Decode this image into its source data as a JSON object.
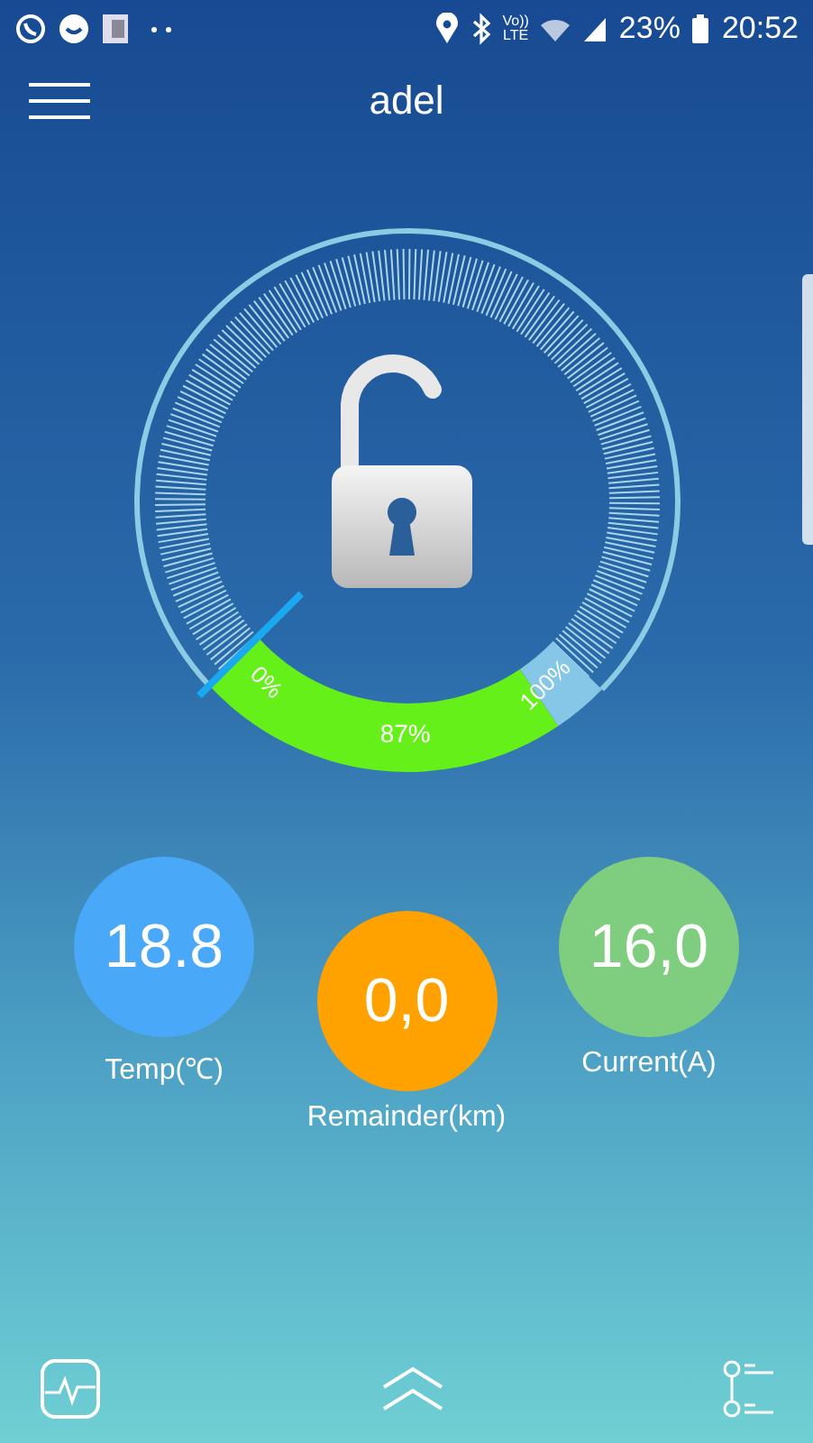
{
  "status_bar": {
    "volte_top": "Vo))",
    "volte_bottom": "LTE",
    "battery": "23%",
    "time": "20:52"
  },
  "header": {
    "title": "adel"
  },
  "gauge": {
    "locked": false,
    "start_label": "0%",
    "value_label": "87%",
    "end_label": "100%"
  },
  "metrics": [
    {
      "value": "18.8",
      "label": "Temp(℃)",
      "color": "#4aa8f8"
    },
    {
      "value": "0,0",
      "label": "Remainder(km)",
      "color": "#ffa200"
    },
    {
      "value": "16,0",
      "label": "Current(A)",
      "color": "#7fcd7e"
    }
  ]
}
